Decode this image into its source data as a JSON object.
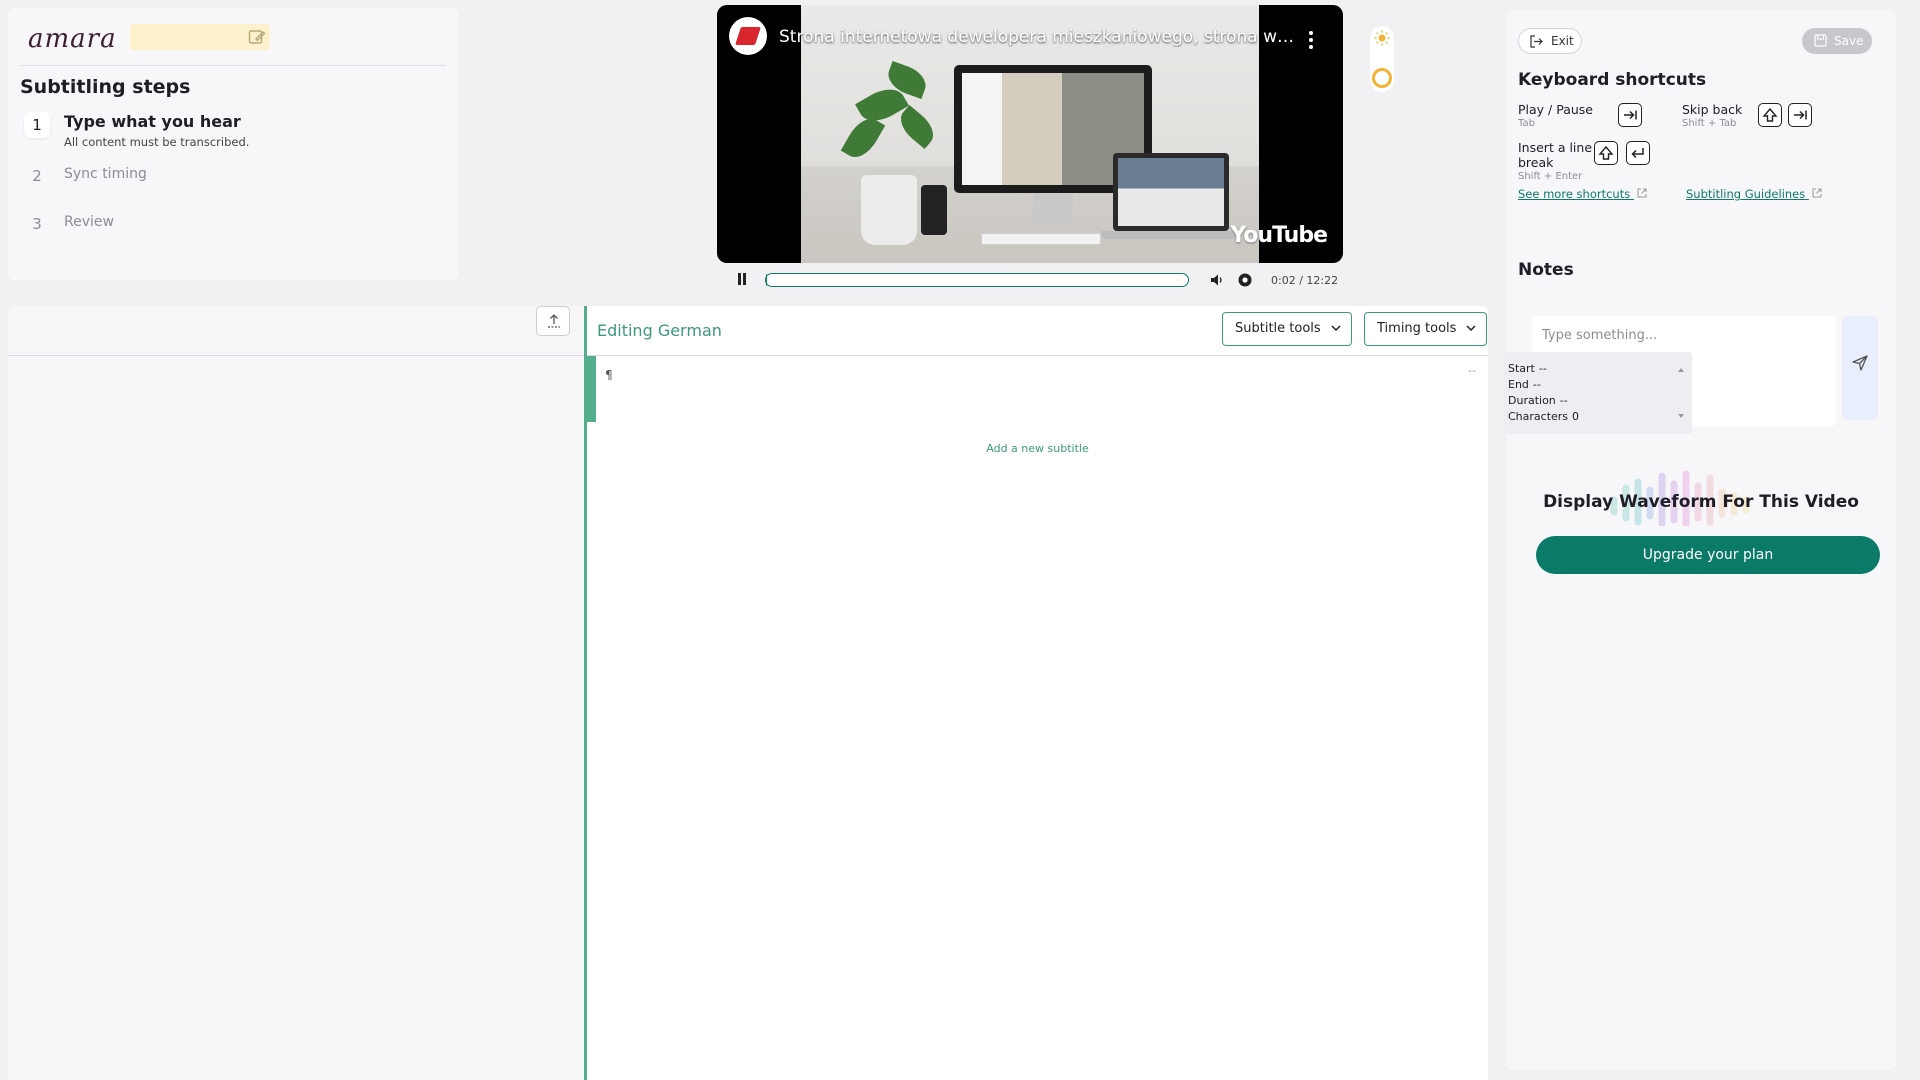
{
  "header": {
    "logo": "amara"
  },
  "steps": {
    "heading": "Subtitling steps",
    "items": [
      {
        "number": "1",
        "label": "Type what you hear",
        "sub": "All content must be transcribed."
      },
      {
        "number": "2",
        "label": "Sync timing"
      },
      {
        "number": "3",
        "label": "Review"
      }
    ]
  },
  "video": {
    "title": "Strona internetowa dewelopera mieszkaniowego, strona www...",
    "watermark": "YouTube",
    "time": "0:02 / 12:22",
    "progress_fraction": 0.003
  },
  "toolbar": {
    "exit_label": "Exit",
    "save_label": "Save"
  },
  "shortcuts": {
    "heading": "Keyboard shortcuts",
    "play_pause": {
      "label": "Play / Pause",
      "keys": "Tab"
    },
    "skip_back": {
      "label": "Skip back",
      "keys": "Shift + Tab"
    },
    "line_break": {
      "label": "Insert a line break",
      "keys": "Shift + Enter"
    },
    "more_link": "See more shortcuts",
    "guidelines_link": "Subtitling Guidelines"
  },
  "notes": {
    "heading": "Notes",
    "placeholder": "Type something..."
  },
  "timing_popover": {
    "start_label": "Start",
    "start_value": "--",
    "end_label": "End",
    "end_value": "--",
    "duration_label": "Duration",
    "duration_value": "--",
    "chars_label": "Characters",
    "chars_value": "0"
  },
  "waveform": {
    "heading": "Display Waveform For This Video",
    "upgrade_label": "Upgrade your plan"
  },
  "editor": {
    "editing_label": "Editing German",
    "subtitle_tools": "Subtitle tools",
    "timing_tools": "Timing tools",
    "pilcrow": "¶",
    "row_dash": "--",
    "add_subtitle": "Add a new subtitle"
  },
  "colors": {
    "accent": "#0b7a69",
    "accent_light": "#55ad8c",
    "title_field": "#fbf1cc",
    "theme_toggle": "#f3b335"
  }
}
